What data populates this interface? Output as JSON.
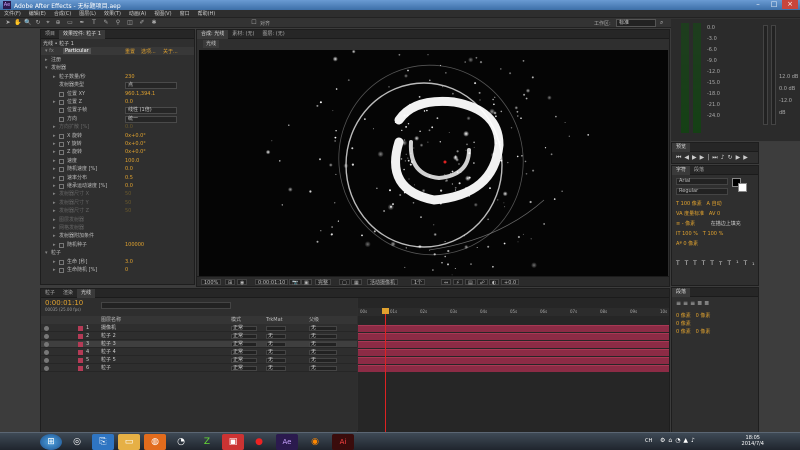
{
  "window": {
    "title": "Adobe After Effects - 无标题项目.aep"
  },
  "menu": [
    "文件(F)",
    "编辑(E)",
    "合成(C)",
    "图层(L)",
    "效果(T)",
    "动画(A)",
    "视图(V)",
    "窗口",
    "帮助(H)"
  ],
  "toolbar": {
    "snap_label": "对齐",
    "workspace_label": "工作区:",
    "workspace_value": "标准"
  },
  "effects_panel": {
    "tabs": [
      "项目",
      "效果控件: 粒子 1"
    ],
    "header": "光线 • 粒子 1",
    "effect_name": "Particular",
    "effect_links": [
      "重置",
      "选项...",
      "关于..."
    ],
    "rows": [
      {
        "name": "注册",
        "value": "",
        "indent": 1,
        "arrow": "▸"
      },
      {
        "name": "发射器",
        "value": "",
        "indent": 1,
        "arrow": "▾"
      },
      {
        "name": "粒子数量/秒",
        "value": "230",
        "indent": 2,
        "arrow": "▸"
      },
      {
        "name": "发射器类型",
        "value": "点",
        "indent": 2,
        "arrow": "",
        "dropdown": true
      },
      {
        "name": "位置 XY",
        "value": "960.1,394.1",
        "indent": 2,
        "arrow": "",
        "sw": true
      },
      {
        "name": "位置 Z",
        "value": "0.0",
        "indent": 2,
        "arrow": "▸",
        "sw": true
      },
      {
        "name": "位置子帧",
        "value": "线性 (1倍)",
        "indent": 2,
        "arrow": "",
        "dropdown": true,
        "sw": true
      },
      {
        "name": "方向",
        "value": "统一",
        "indent": 2,
        "arrow": "",
        "dropdown": true,
        "sw": true
      },
      {
        "name": "方向扩散 [%]",
        "value": "0.0",
        "indent": 2,
        "arrow": "▸",
        "dim": true
      },
      {
        "name": "X 旋转",
        "value": "0x+0.0°",
        "indent": 2,
        "arrow": "▸",
        "sw": true
      },
      {
        "name": "Y 旋转",
        "value": "0x+0.0°",
        "indent": 2,
        "arrow": "▸",
        "sw": true
      },
      {
        "name": "Z 旋转",
        "value": "0x+0.0°",
        "indent": 2,
        "arrow": "▸",
        "sw": true
      },
      {
        "name": "速度",
        "value": "100.0",
        "indent": 2,
        "arrow": "▸",
        "sw": true
      },
      {
        "name": "随机速度 [%]",
        "value": "0.0",
        "indent": 2,
        "arrow": "▸",
        "sw": true
      },
      {
        "name": "速率分布",
        "value": "0.5",
        "indent": 2,
        "arrow": "▸",
        "sw": true
      },
      {
        "name": "继承运动速度 [%]",
        "value": "0.0",
        "indent": 2,
        "arrow": "▸",
        "sw": true
      },
      {
        "name": "发射器尺寸 X",
        "value": "50",
        "indent": 2,
        "arrow": "▸",
        "dim": true
      },
      {
        "name": "发射器尺寸 Y",
        "value": "50",
        "indent": 2,
        "arrow": "▸",
        "dim": true
      },
      {
        "name": "发射器尺寸 Z",
        "value": "50",
        "indent": 2,
        "arrow": "▸",
        "dim": true
      },
      {
        "name": "图层发射器",
        "value": "",
        "indent": 2,
        "arrow": "▸",
        "dim": true
      },
      {
        "name": "网格发射器",
        "value": "",
        "indent": 2,
        "arrow": "▸",
        "dim": true
      },
      {
        "name": "发射器附加条件",
        "value": "",
        "indent": 2,
        "arrow": "▸"
      },
      {
        "name": "随机种子",
        "value": "100000",
        "indent": 2,
        "arrow": "▸",
        "sw": true
      },
      {
        "name": "粒子",
        "value": "",
        "indent": 1,
        "arrow": "▾"
      },
      {
        "name": "生命 [秒]",
        "value": "3.0",
        "indent": 2,
        "arrow": "▸",
        "sw": true
      },
      {
        "name": "生命随机 [%]",
        "value": "0",
        "indent": 2,
        "arrow": "▸",
        "sw": true
      }
    ]
  },
  "composition": {
    "tabs": [
      "合成: 光线",
      "素材: (无)",
      "图层: (无)"
    ],
    "active_sub_tab": "光线",
    "zoom": "100%",
    "timecode": "0:00:01:10",
    "resolution": "完整",
    "camera": "活动摄像机",
    "views": "1个",
    "exposure": "+0.0"
  },
  "audio_meter": {
    "scale": [
      "0.0",
      "-3.0",
      "-6.0",
      "-9.0",
      "-12.0",
      "-15.0",
      "-18.0",
      "-21.0",
      "-24.0"
    ],
    "right_scale": [
      "12.0 dB",
      "0.0 dB",
      "-12.0 dB"
    ]
  },
  "preview_panel": {
    "title": "预览",
    "tab2": "效果和预设"
  },
  "character_panel": {
    "tabs": [
      "字符",
      "段落"
    ],
    "font": "Arial",
    "style": "Regular",
    "size": "100",
    "leading": "自动",
    "tracking": "0",
    "scale_v": "100 %",
    "scale_h": "100 %",
    "baseline": "0 像素",
    "stroke": "在描边上填充"
  },
  "paragraph_panel": {
    "title": "段落",
    "values": [
      "0 像素",
      "0 像素",
      "0 像素",
      "0 像素",
      "0 像素"
    ]
  },
  "timeline": {
    "tabs": [
      "粒子",
      "渲染",
      "光线"
    ],
    "active_tab": "光线",
    "timecode": "0:00:01:10",
    "frame": "00035 (25.00 fps)",
    "columns": {
      "source": "图层名称",
      "mode": "模式",
      "trkmat": "TrkMat",
      "parent": "父级"
    },
    "layers": [
      {
        "num": "1",
        "name": "摄像机",
        "mode": "正常",
        "trk": "",
        "parent": "无"
      },
      {
        "num": "2",
        "name": "粒子 2",
        "mode": "正常",
        "trk": "无",
        "parent": "无"
      },
      {
        "num": "3",
        "name": "粒子 3",
        "mode": "正常",
        "trk": "无",
        "parent": "无"
      },
      {
        "num": "4",
        "name": "粒子 4",
        "mode": "正常",
        "trk": "无",
        "parent": "无"
      },
      {
        "num": "5",
        "name": "粒子 5",
        "mode": "正常",
        "trk": "无",
        "parent": "无"
      },
      {
        "num": "6",
        "name": "粒子",
        "mode": "正常",
        "trk": "无",
        "parent": "无"
      }
    ],
    "ruler": [
      "00s",
      "01s",
      "02s",
      "03s",
      "04s",
      "05s",
      "06s",
      "07s",
      "08s",
      "09s",
      "10s"
    ]
  },
  "taskbar": {
    "time": "18:05",
    "date": "2014/7/4",
    "lang": "CH"
  },
  "colors": {
    "label": "#b43b56",
    "bar": "#8c2b45",
    "value": "#e0a22f"
  }
}
